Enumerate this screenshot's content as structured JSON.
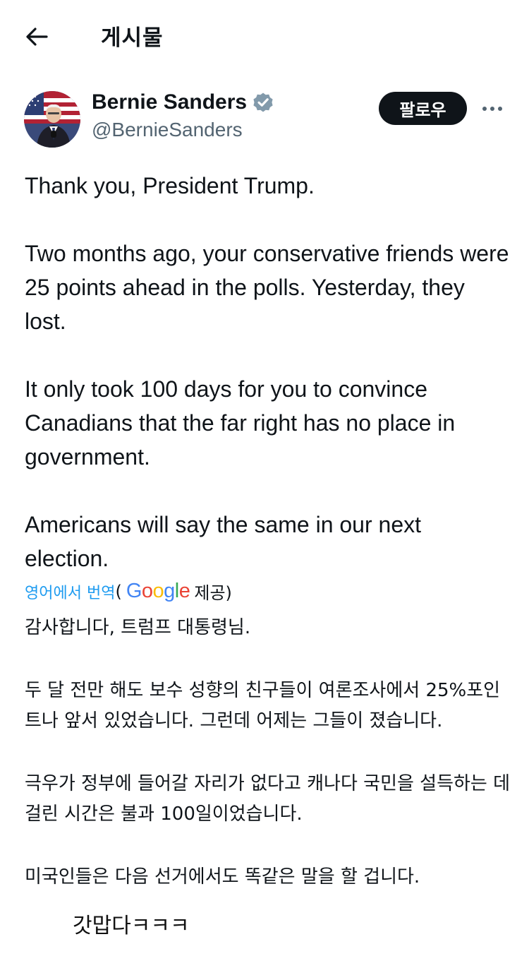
{
  "header": {
    "back_icon": "arrow-left-icon",
    "title": "게시물"
  },
  "author": {
    "name": "Bernie Sanders",
    "handle": "@BernieSanders",
    "verified_icon": "verified-badge-icon",
    "verified_color": "#829aab"
  },
  "actions": {
    "follow_label": "팔로우",
    "more_icon": "more-dots-icon"
  },
  "tweet": {
    "paragraphs": [
      "Thank you, President Trump.",
      "Two months ago, your conservative friends were 25 points ahead in the polls. Yesterday, they lost.",
      "It only took 100 days for you to convince Canadians that the far right has no place in government.",
      "Americans will say the same in our next election."
    ]
  },
  "translation": {
    "link_label": "영어에서 번역",
    "open_paren": "(",
    "provider": "Google",
    "provided_label": "제공)",
    "link_color": "#1d9bf0",
    "paragraphs": [
      "감사합니다, 트럼프 대통령님.",
      "두 달 전만 해도 보수 성향의 친구들이 여론조사에서 25%포인트나 앞서 있었습니다. 그런데 어제는 그들이 졌습니다.",
      "극우가 정부에 들어갈 자리가 없다고 캐나다 국민을 설득하는 데 걸린 시간은 불과 100일이었습니다.",
      "미국인들은 다음 선거에서도 똑같은 말을 할 겁니다."
    ]
  },
  "caption": "갓맙다ㅋㅋㅋ"
}
